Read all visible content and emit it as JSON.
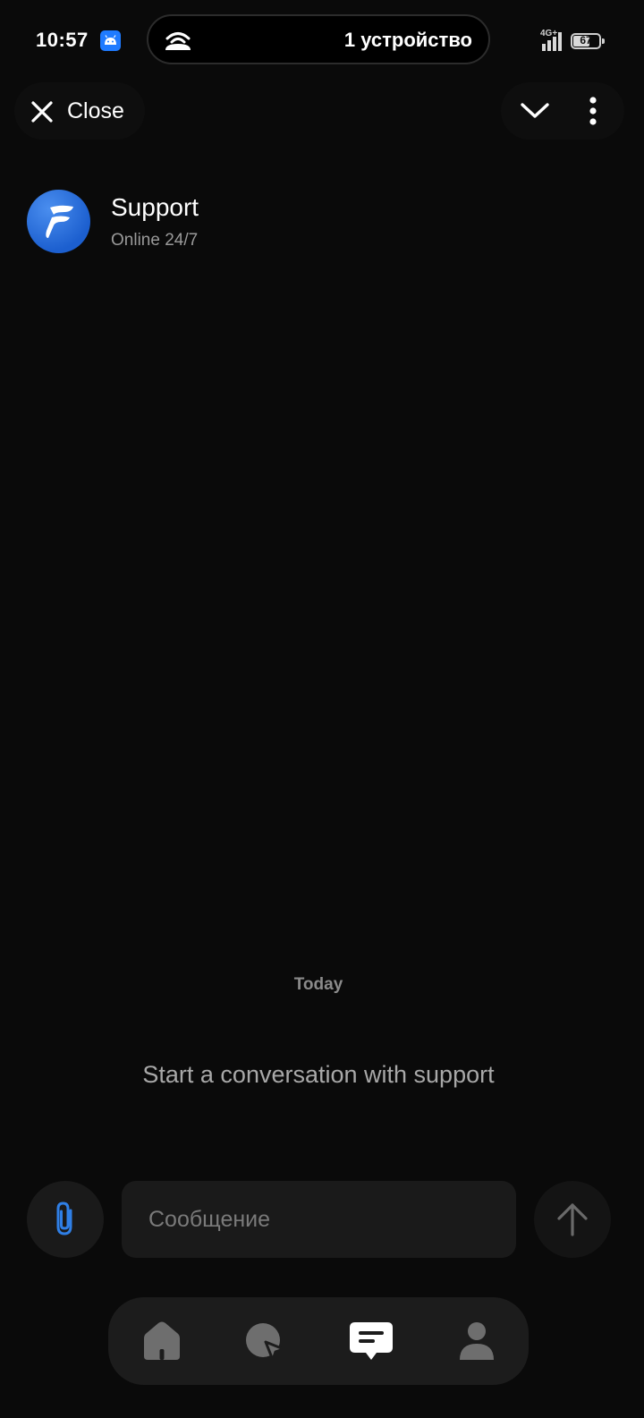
{
  "status_bar": {
    "time": "10:57",
    "island_text": "1 устройство",
    "network": "4G+",
    "battery": "67",
    "battery_level_percent": 67
  },
  "top_bar": {
    "close_label": "Close",
    "icons": [
      "close-icon",
      "chevron-down-icon",
      "more-vertical-icon"
    ]
  },
  "chat": {
    "name": "Support",
    "status": "Online 24/7",
    "date_label": "Today",
    "empty_text": "Start a conversation with support"
  },
  "composer": {
    "placeholder": "Сообщение",
    "value": "",
    "icons": [
      "paperclip-icon",
      "arrow-up-icon"
    ]
  },
  "bottom_nav": {
    "items": [
      {
        "icon": "home-icon",
        "active": false
      },
      {
        "icon": "explore-icon",
        "active": false
      },
      {
        "icon": "chat-icon",
        "active": true
      },
      {
        "icon": "profile-icon",
        "active": false
      }
    ]
  },
  "colors": {
    "background": "#0a0a0a",
    "surface": "#1a1a1a",
    "accent": "#2f7fe6",
    "text_primary": "#ffffff",
    "text_secondary": "#9a9a9a"
  }
}
